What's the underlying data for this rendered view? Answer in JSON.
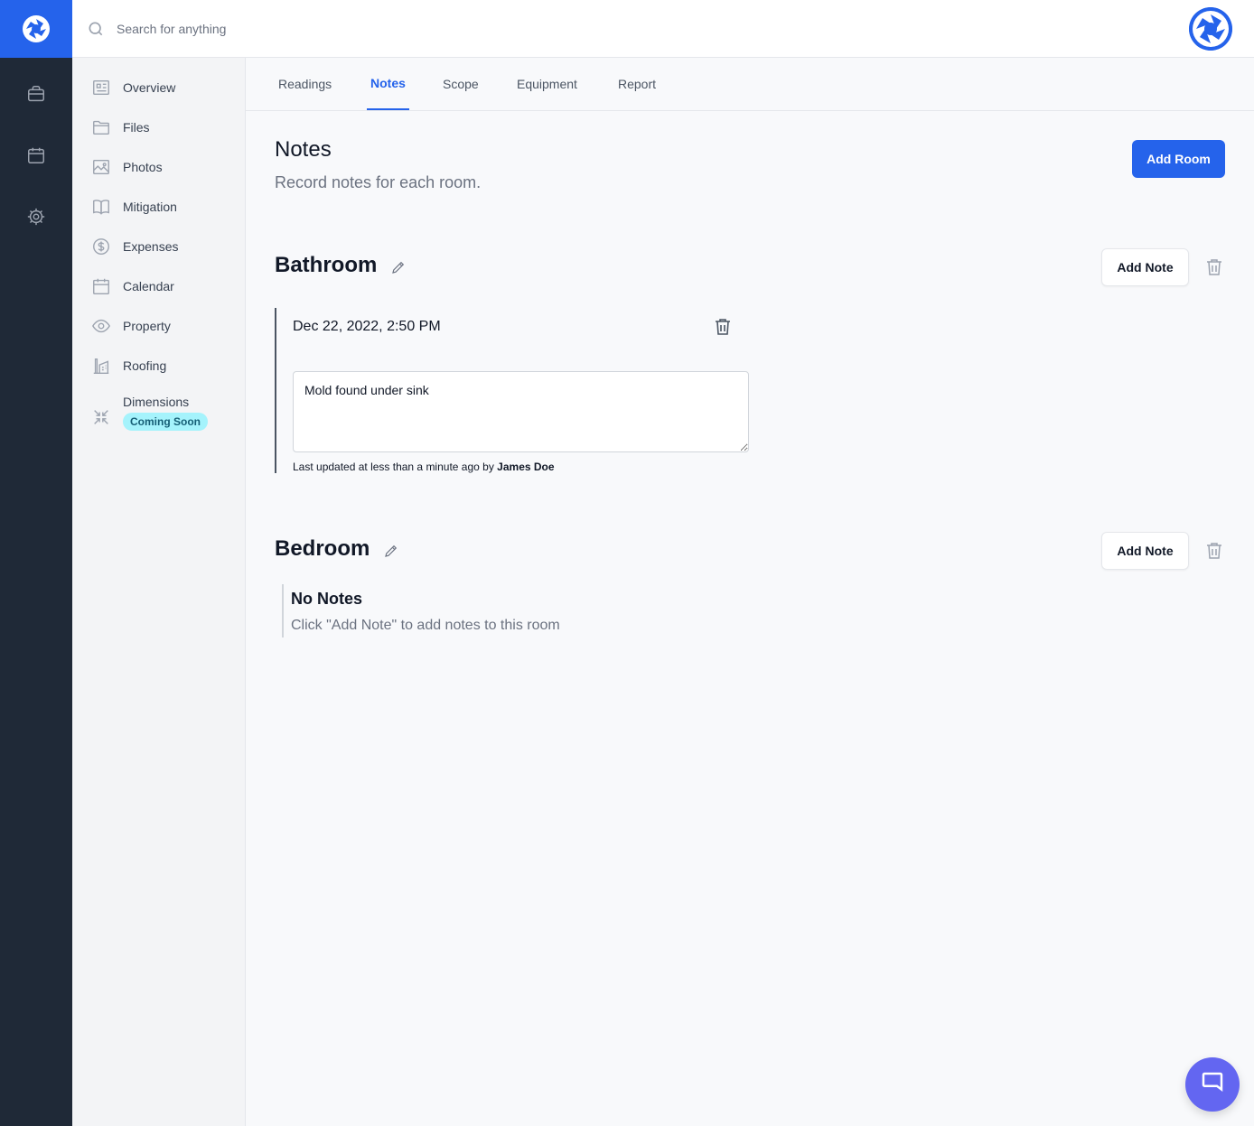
{
  "search": {
    "placeholder": "Search for anything"
  },
  "rail": {
    "icons": [
      "logo-icon",
      "briefcase-icon",
      "calendar-icon",
      "gear-icon"
    ]
  },
  "subnav": {
    "items": [
      {
        "label": "Overview",
        "icon": "overview-icon"
      },
      {
        "label": "Files",
        "icon": "folder-icon"
      },
      {
        "label": "Photos",
        "icon": "photo-icon"
      },
      {
        "label": "Mitigation",
        "icon": "book-icon"
      },
      {
        "label": "Expenses",
        "icon": "dollar-icon"
      },
      {
        "label": "Calendar",
        "icon": "calendar-icon"
      },
      {
        "label": "Property",
        "icon": "eye-icon"
      },
      {
        "label": "Roofing",
        "icon": "building-icon"
      },
      {
        "label": "Dimensions",
        "icon": "shrink-icon",
        "badge": "Coming Soon"
      }
    ]
  },
  "tabs": [
    {
      "label": "Readings",
      "active": false
    },
    {
      "label": "Notes",
      "active": true
    },
    {
      "label": "Scope",
      "active": false
    },
    {
      "label": "Equipment",
      "active": false
    },
    {
      "label": "Report",
      "active": false
    }
  ],
  "header": {
    "title": "Notes",
    "subtitle": "Record notes for each room.",
    "add_room_label": "Add Room"
  },
  "rooms": [
    {
      "name": "Bathroom",
      "add_note_label": "Add Note",
      "notes": [
        {
          "date": "Dec 22, 2022, 2:50 PM",
          "text": "Mold found under sink",
          "meta_prefix": "Last updated at less than a minute ago by",
          "author": "James Doe"
        }
      ]
    },
    {
      "name": "Bedroom",
      "add_note_label": "Add Note",
      "empty_title": "No Notes",
      "empty_subtitle": "Click \"Add Note\" to add notes to this room"
    }
  ],
  "colors": {
    "primary": "#2563eb",
    "rail": "#1f2937",
    "badge_bg": "#a5f3fc",
    "chat": "#6366f1"
  }
}
